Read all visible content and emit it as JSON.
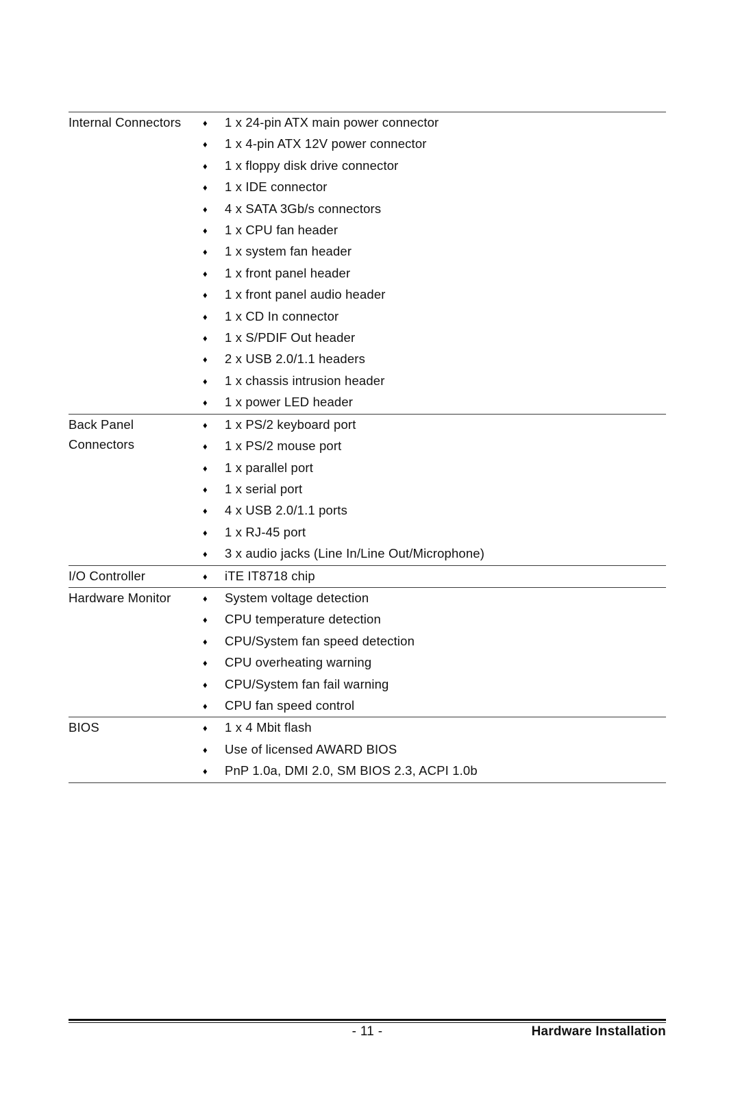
{
  "document": {
    "page_number_label": "- 11 -",
    "section_title": "Hardware Installation",
    "bullet_glyph": "♦"
  },
  "spec_table": {
    "rows": [
      {
        "label": "Internal Connectors",
        "items": [
          "1 x 24-pin ATX main power connector",
          "1 x 4-pin ATX 12V power connector",
          "1 x floppy disk drive connector",
          "1 x IDE connector",
          "4 x SATA 3Gb/s connectors",
          "1 x CPU fan header",
          "1 x system fan header",
          "1 x front panel header",
          "1 x front panel audio header",
          "1 x CD In connector",
          "1 x S/PDIF Out header",
          "2 x USB 2.0/1.1 headers",
          "1 x chassis intrusion header",
          "1 x power LED header"
        ]
      },
      {
        "label": "Back Panel\nConnectors",
        "items": [
          "1 x PS/2 keyboard port",
          "1 x PS/2 mouse port",
          "1 x parallel port",
          "1 x serial port",
          "4 x USB 2.0/1.1 ports",
          "1 x RJ-45 port",
          "3 x audio jacks (Line In/Line Out/Microphone)"
        ]
      },
      {
        "label": "I/O Controller",
        "items": [
          "iTE IT8718 chip"
        ]
      },
      {
        "label": "Hardware Monitor",
        "items": [
          "System voltage detection",
          "CPU temperature detection",
          "CPU/System fan speed detection",
          "CPU overheating warning",
          "CPU/System fan fail warning",
          "CPU fan speed control"
        ]
      },
      {
        "label": "BIOS",
        "items": [
          "1 x 4 Mbit flash",
          "Use of licensed AWARD BIOS",
          "PnP 1.0a, DMI 2.0, SM BIOS 2.3, ACPI 1.0b"
        ]
      }
    ]
  },
  "colors": {
    "text": "#111111",
    "rule": "#3a3a3a",
    "footer_rule": "#111111",
    "background": "#ffffff"
  }
}
